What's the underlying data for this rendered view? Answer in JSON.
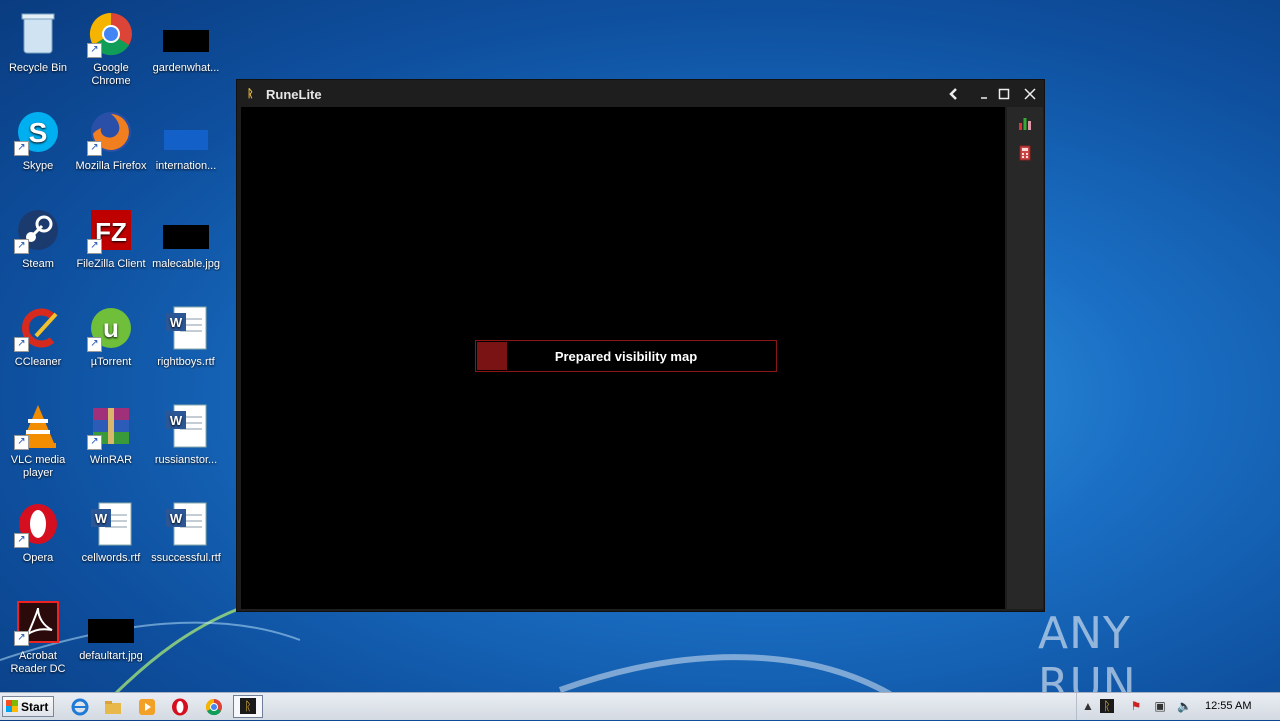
{
  "desktop": {
    "icons": [
      {
        "label": "Recycle Bin",
        "icon": "recycle-bin-icon"
      },
      {
        "label": "Google Chrome",
        "icon": "chrome-icon"
      },
      {
        "label": "gardenwhat...",
        "icon": "image-file-icon"
      },
      {
        "label": "Skype",
        "icon": "skype-icon"
      },
      {
        "label": "Mozilla Firefox",
        "icon": "firefox-icon"
      },
      {
        "label": "internation...",
        "icon": "image-file-icon"
      },
      {
        "label": "Steam",
        "icon": "steam-icon"
      },
      {
        "label": "FileZilla Client",
        "icon": "filezilla-icon"
      },
      {
        "label": "malecable.jpg",
        "icon": "image-file-icon"
      },
      {
        "label": "CCleaner",
        "icon": "ccleaner-icon"
      },
      {
        "label": "µTorrent",
        "icon": "utorrent-icon"
      },
      {
        "label": "rightboys.rtf",
        "icon": "word-document-icon"
      },
      {
        "label": "VLC media player",
        "icon": "vlc-icon"
      },
      {
        "label": "WinRAR",
        "icon": "winrar-icon"
      },
      {
        "label": "russianstor...",
        "icon": "word-document-icon"
      },
      {
        "label": "Opera",
        "icon": "opera-icon"
      },
      {
        "label": "cellwords.rtf",
        "icon": "word-document-icon"
      },
      {
        "label": "ssuccessful.rtf",
        "icon": "word-document-icon"
      },
      {
        "label": "Acrobat Reader DC",
        "icon": "acrobat-icon"
      },
      {
        "label": "defaultart.jpg",
        "icon": "image-file-icon"
      }
    ]
  },
  "window": {
    "title": "RuneLite",
    "loading": {
      "text": "Prepared visibility map",
      "progress": 0.1
    },
    "controls": [
      "back-icon",
      "minimize-icon",
      "maximize-icon",
      "close-icon"
    ],
    "sidebar_icons": [
      "bar-chart-icon",
      "calculator-icon"
    ]
  },
  "watermark": "ANY RUN",
  "taskbar": {
    "start_label": "Start",
    "clock": "12:55 AM"
  },
  "colors": {
    "accent_red": "#7a1414",
    "window_bg": "#1e1e1e"
  }
}
